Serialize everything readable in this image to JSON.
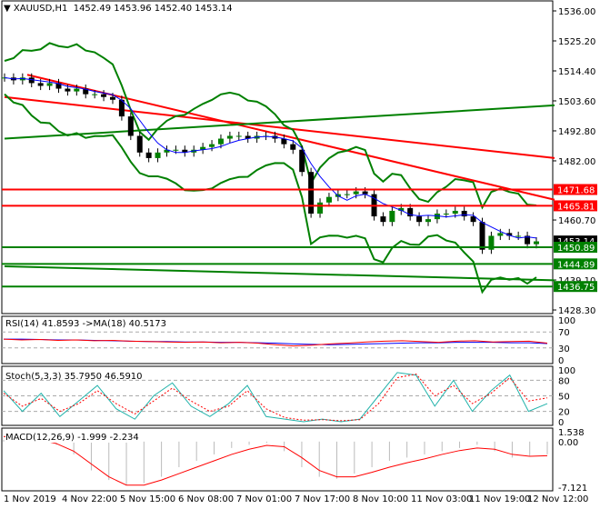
{
  "header": {
    "symbol": "XAUUSD,H1",
    "ohlc": "1452.49 1453.96 1452.40 1453.14"
  },
  "chart_data": [
    {
      "type": "candlestick",
      "title": "XAUUSD,H1",
      "ylim": [
        1428.3,
        1536.0
      ],
      "y_ticks": [
        "1536.00",
        "1525.20",
        "1514.40",
        "1503.60",
        "1492.80",
        "1482.00",
        "1460.70",
        "1439.10",
        "1428.30"
      ],
      "closes": [
        1512,
        1511,
        1512,
        1510,
        1509,
        1510,
        1508,
        1507,
        1508,
        1506,
        1506,
        1505,
        1504,
        1498,
        1491,
        1485,
        1483,
        1485,
        1486,
        1486,
        1485,
        1486,
        1487,
        1488,
        1490,
        1491,
        1491,
        1490,
        1491,
        1491,
        1490,
        1488,
        1486,
        1478,
        1463,
        1467,
        1469,
        1470,
        1470,
        1471,
        1470,
        1462,
        1460,
        1464,
        1465,
        1462,
        1460,
        1461,
        1463,
        1463,
        1464,
        1462,
        1460,
        1450,
        1455,
        1456,
        1455,
        1455,
        1452,
        1453
      ],
      "price_labels": [
        {
          "text": "1471.68",
          "value": 1471.68,
          "color": "#ff0000"
        },
        {
          "text": "1465.81",
          "value": 1465.81,
          "color": "#ff0000"
        },
        {
          "text": "1453.14",
          "value": 1453.14,
          "color": "#000000"
        },
        {
          "text": "1450.89",
          "value": 1450.89,
          "color": "#008000"
        },
        {
          "text": "1444.89",
          "value": 1444.89,
          "color": "#008000"
        },
        {
          "text": "1436.75",
          "value": 1436.75,
          "color": "#008000"
        }
      ]
    },
    {
      "type": "line",
      "title": "RSI(14) 41.8593  ->MA(18) 40.5173",
      "ylim": [
        0,
        100
      ],
      "y_ticks": [
        "100",
        "70",
        "30",
        "0"
      ],
      "rsi": [
        52,
        50,
        51,
        49,
        50,
        48,
        49,
        47,
        46,
        45,
        44,
        45,
        43,
        44,
        42,
        38,
        35,
        37,
        40,
        42,
        45,
        47,
        48,
        46,
        44,
        47,
        48,
        45,
        46,
        47,
        42
      ],
      "ma": [
        52,
        52,
        51,
        50,
        50,
        49,
        48,
        47,
        46,
        46,
        45,
        45,
        44,
        44,
        43,
        42,
        40,
        39,
        38,
        39,
        40,
        41,
        42,
        43,
        43,
        44,
        44,
        44,
        43,
        43,
        41
      ]
    },
    {
      "type": "line",
      "title": "Stoch(5,3,3) 35.7950 46.5910",
      "ylim": [
        0,
        100
      ],
      "y_ticks": [
        "100",
        "80",
        "50",
        "20",
        "0"
      ],
      "main": [
        60,
        20,
        55,
        10,
        40,
        70,
        25,
        5,
        50,
        75,
        30,
        10,
        35,
        70,
        10,
        5,
        0,
        5,
        0,
        5,
        50,
        95,
        90,
        30,
        80,
        20,
        60,
        90,
        20,
        35
      ],
      "signal": [
        55,
        30,
        45,
        20,
        35,
        60,
        35,
        15,
        40,
        65,
        40,
        20,
        30,
        60,
        25,
        8,
        3,
        4,
        2,
        4,
        35,
        85,
        92,
        50,
        70,
        35,
        55,
        85,
        40,
        46
      ]
    },
    {
      "type": "bar+line",
      "title": "MACD(12,26,9) -1.999 -2.234",
      "ylim": [
        -7.121,
        1.538
      ],
      "y_ticks": [
        "1.538",
        "0.00",
        "-7.121"
      ],
      "hist": [
        0.3,
        0.2,
        0,
        -0.5,
        -2,
        -4.5,
        -6,
        -6.8,
        -6.5,
        -5.5,
        -4,
        -3,
        -2,
        -1,
        -0.5,
        -0.2,
        -1.5,
        -4,
        -5.5,
        -5.8,
        -5,
        -4,
        -3,
        -2.5,
        -2,
        -1.5,
        -1,
        -0.5,
        -1.5,
        -2.5,
        -2.2,
        -2
      ],
      "signal": [
        0.8,
        0.6,
        0.3,
        -0.3,
        -1.5,
        -3.5,
        -5.5,
        -6.8,
        -6.8,
        -6,
        -5,
        -4,
        -3,
        -2,
        -1.2,
        -0.6,
        -0.8,
        -2.5,
        -4.5,
        -5.5,
        -5.5,
        -4.8,
        -4,
        -3.3,
        -2.7,
        -2,
        -1.4,
        -1,
        -1.2,
        -2,
        -2.3,
        -2.2
      ]
    },
    {
      "type": "axis",
      "x_ticks": [
        "1 Nov 2019",
        "4 Nov 22:00",
        "5 Nov 15:00",
        "6 Nov 08:00",
        "7 Nov 01:00",
        "7 Nov 17:00",
        "8 Nov 10:00",
        "11 Nov 03:00",
        "11 Nov 19:00",
        "12 Nov 12:00"
      ]
    }
  ]
}
